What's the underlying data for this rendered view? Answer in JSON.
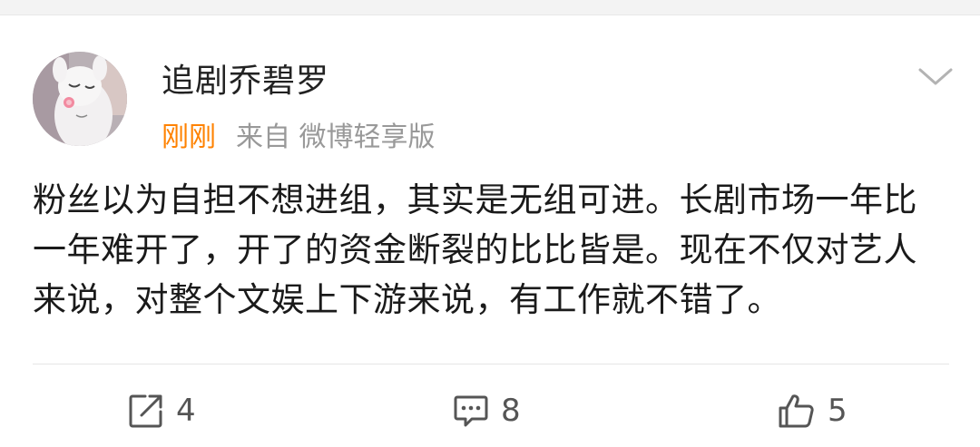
{
  "post": {
    "username": "追剧乔碧罗",
    "time": "刚刚",
    "source": "来自 微博轻享版",
    "content": "粉丝以为自担不想进组，其实是无组可进。长剧市场一年比一年难开了，开了的资金断裂的比比皆是。现在不仅对艺人来说，对整个文娱上下游来说，有工作就不错了。"
  },
  "actions": {
    "repost_count": "4",
    "comment_count": "8",
    "like_count": "5"
  },
  "colors": {
    "time": "#ff8200",
    "meta": "#999999",
    "text": "#1a1a1a",
    "icons": "#555555"
  },
  "icons": {
    "repost": "share-square-arrow-icon",
    "comment": "speech-bubble-icon",
    "like": "thumbs-up-icon",
    "more": "chevron-down-icon"
  }
}
